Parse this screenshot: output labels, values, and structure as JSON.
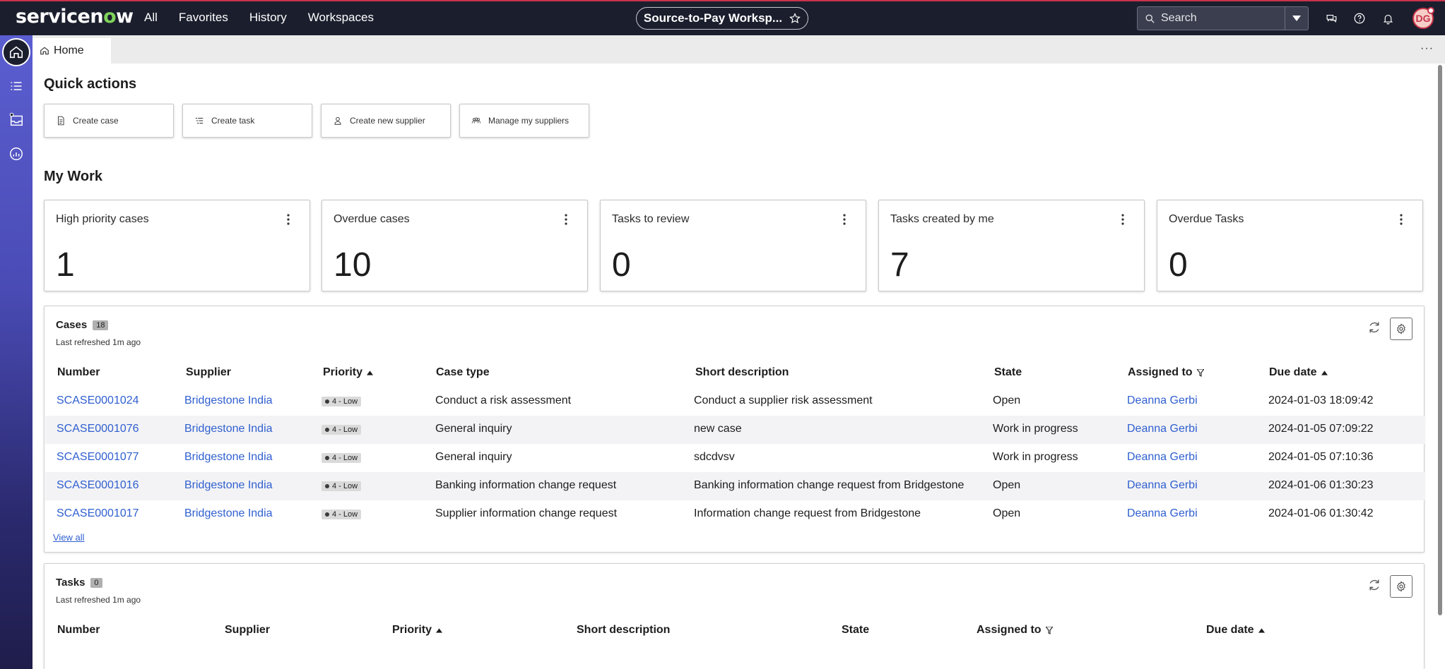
{
  "nav": {
    "logo_pre": "servicen",
    "logo_o": "o",
    "logo_post": "w",
    "links": [
      "All",
      "Favorites",
      "History",
      "Workspaces"
    ],
    "workspace_pill": "Source-to-Pay Worksp...",
    "search_placeholder": "Search",
    "avatar_initials": "DG"
  },
  "tabs": {
    "home_label": "Home",
    "more": "···"
  },
  "quick_actions": {
    "title": "Quick actions",
    "items": [
      "Create case",
      "Create task",
      "Create new supplier",
      "Manage my suppliers"
    ]
  },
  "my_work": {
    "title": "My Work",
    "cards": [
      {
        "title": "High priority cases",
        "value": "1"
      },
      {
        "title": "Overdue cases",
        "value": "10"
      },
      {
        "title": "Tasks to review",
        "value": "0"
      },
      {
        "title": "Tasks created by me",
        "value": "7"
      },
      {
        "title": "Overdue Tasks",
        "value": "0"
      }
    ]
  },
  "cases": {
    "title": "Cases",
    "count": "18",
    "refreshed": "Last refreshed 1m ago",
    "columns": [
      "Number",
      "Supplier",
      "Priority",
      "Case type",
      "Short description",
      "State",
      "Assigned to",
      "Due date"
    ],
    "rows": [
      {
        "number": "SCASE0001024",
        "supplier": "Bridgestone India",
        "priority": "4 - Low",
        "case_type": "Conduct a risk assessment",
        "short_description": "Conduct a supplier risk assessment",
        "state": "Open",
        "assigned_to": "Deanna Gerbi",
        "due_date": "2024-01-03 18:09:42"
      },
      {
        "number": "SCASE0001076",
        "supplier": "Bridgestone India",
        "priority": "4 - Low",
        "case_type": "General inquiry",
        "short_description": "new case",
        "state": "Work in progress",
        "assigned_to": "Deanna Gerbi",
        "due_date": "2024-01-05 07:09:22"
      },
      {
        "number": "SCASE0001077",
        "supplier": "Bridgestone India",
        "priority": "4 - Low",
        "case_type": "General inquiry",
        "short_description": "sdcdvsv",
        "state": "Work in progress",
        "assigned_to": "Deanna Gerbi",
        "due_date": "2024-01-05 07:10:36"
      },
      {
        "number": "SCASE0001016",
        "supplier": "Bridgestone India",
        "priority": "4 - Low",
        "case_type": "Banking information change request",
        "short_description": "Banking information change request from Bridgestone",
        "state": "Open",
        "assigned_to": "Deanna Gerbi",
        "due_date": "2024-01-06 01:30:23"
      },
      {
        "number": "SCASE0001017",
        "supplier": "Bridgestone India",
        "priority": "4 - Low",
        "case_type": "Supplier information change request",
        "short_description": "Information change request from Bridgestone",
        "state": "Open",
        "assigned_to": "Deanna Gerbi",
        "due_date": "2024-01-06 01:30:42"
      }
    ],
    "view_all": "View all"
  },
  "tasks": {
    "title": "Tasks",
    "count": "0",
    "refreshed": "Last refreshed 1m ago",
    "columns": [
      "Number",
      "Supplier",
      "Priority",
      "Short description",
      "State",
      "Assigned to",
      "Due date"
    ]
  }
}
